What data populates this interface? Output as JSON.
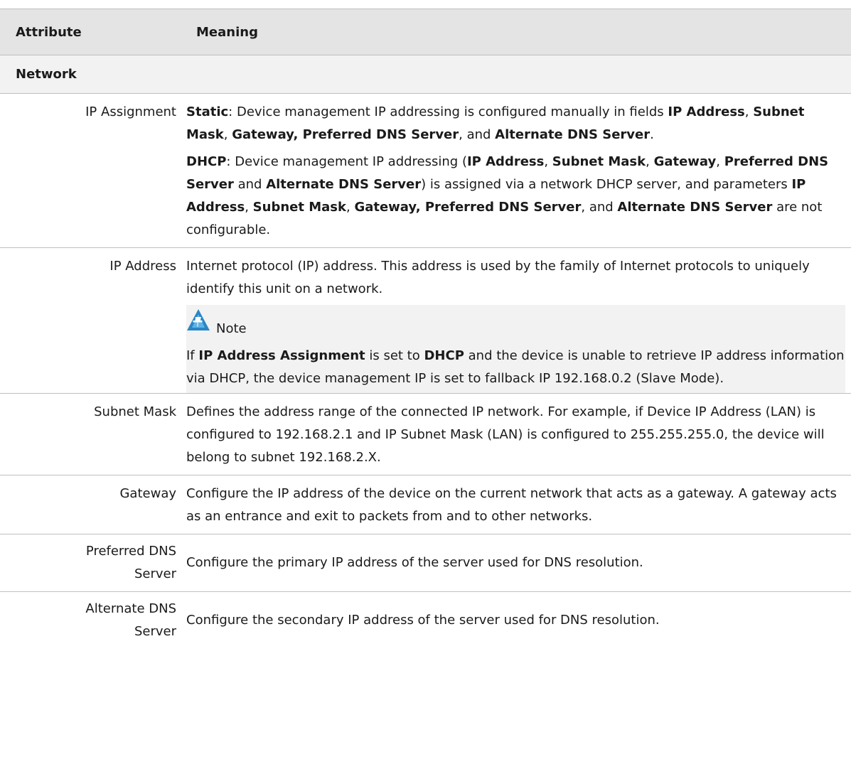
{
  "header": {
    "attribute": "Attribute",
    "meaning": "Meaning"
  },
  "section": "Network",
  "rows": {
    "ip_assignment": {
      "label": "IP Assignment",
      "static": {
        "term": "Static",
        "t1": ":  Device management IP addressing is configured manually in fields ",
        "b1": "IP Address",
        "t2": ", ",
        "b2": "Subnet Mask",
        "t3": ", ",
        "b3": "Gateway, Preferred DNS Server",
        "t4": ", and ",
        "b4": "Alternate DNS Server",
        "t5": "."
      },
      "dhcp": {
        "term": "DHCP",
        "t1": ":  Device management IP addressing (",
        "b1": "IP Address",
        "t2": ", ",
        "b2": "Subnet Mask",
        "t3": ", ",
        "b3": "Gateway",
        "t4": ", ",
        "b4": "Preferred DNS Server",
        "t5": " and ",
        "b5": "Alternate DNS Server",
        "t6": ") is assigned via a network DHCP server, and parameters ",
        "b6": "IP Address",
        "t7": ", ",
        "b7": "Subnet Mask",
        "t8": ", ",
        "b8": "Gateway, Preferred DNS Server",
        "t9": ", and ",
        "b9": "Alternate DNS Server",
        "t10": " are not configurable."
      }
    },
    "ip_address": {
      "label": "IP Address",
      "text": "Internet protocol (IP) address. This address is used by the family of Internet protocols to uniquely identify this unit on a network.",
      "note_label": "Note",
      "note_icon": "note-pin-icon",
      "note": {
        "t1": "If ",
        "b1": "IP Address Assignment",
        "t2": " is set to ",
        "b2": "DHCP",
        "t3": " and the device is unable to retrieve IP address information via DHCP, the device management IP is set to fallback IP 192.168.0.2 (Slave Mode)."
      }
    },
    "subnet_mask": {
      "label": "Subnet Mask",
      "text": "Defines the address range of the connected IP network. For example, if Device IP Address (LAN) is configured to 192.168.2.1 and IP Subnet Mask (LAN) is configured to 255.255.255.0, the device will belong to subnet 192.168.2.X."
    },
    "gateway": {
      "label": "Gateway",
      "text": "Configure the IP address of the device on the current network that acts as a gateway. A gateway acts as an entrance and exit to packets from and to other networks."
    },
    "preferred_dns": {
      "label": "Preferred DNS Server",
      "text": "Configure the primary IP address of the server used for DNS resolution."
    },
    "alternate_dns": {
      "label": "Alternate DNS Server",
      "text": "Configure the secondary IP address of the server used for DNS resolution."
    }
  }
}
